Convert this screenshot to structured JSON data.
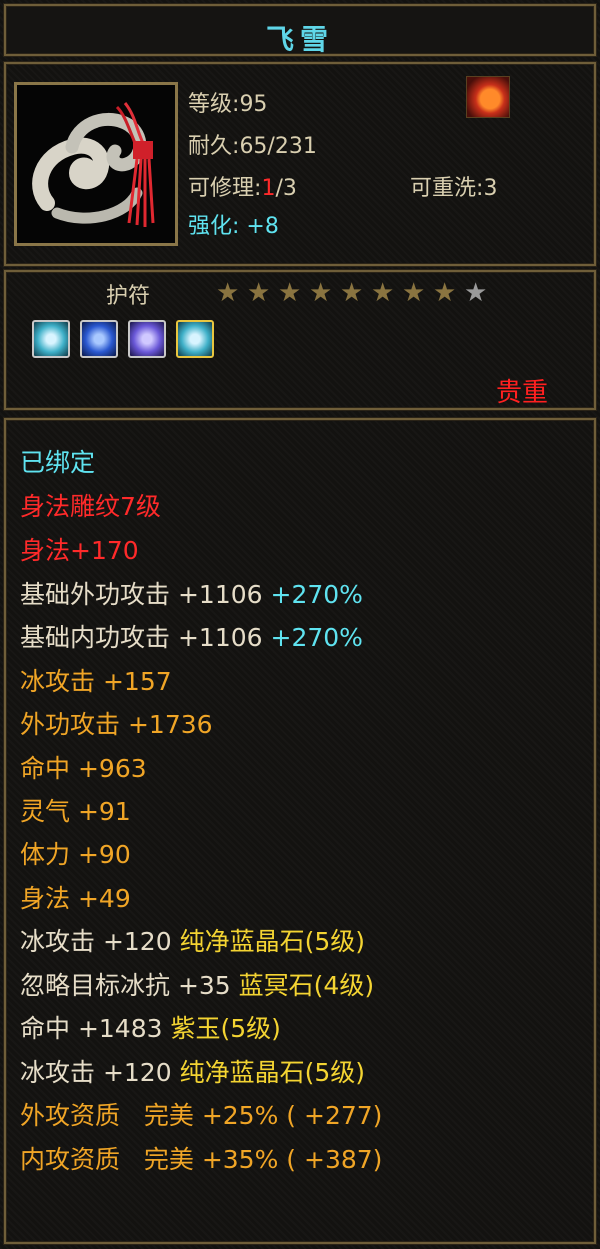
{
  "item": {
    "name": "飞雪",
    "level_label": "等级",
    "level": "95",
    "durability_label": "耐久",
    "durability": "65/231",
    "repairable_label": "可修理",
    "repairable_current": "1",
    "repairable_total": "/3",
    "rewash_label": "可重洗",
    "rewash": "3",
    "enhance_label": "强化",
    "enhance": "+8",
    "type": "护符",
    "stars_filled": 8,
    "stars_total": 9,
    "rarity": "贵重",
    "gem_slots": [
      {
        "icon": "cyan-gem-icon",
        "color": "#3fb0c8"
      },
      {
        "icon": "blue-gem-icon",
        "color": "#2a58d0"
      },
      {
        "icon": "purple-gem-icon",
        "color": "#6a58d8"
      },
      {
        "icon": "cyan-gem-icon",
        "color": "#3fb0c8"
      }
    ]
  },
  "attributes": {
    "bound": "已绑定",
    "engraving": "身法雕纹7级",
    "engraving_bonus": "身法+170",
    "base_ext_attack": {
      "label": "基础外功攻击",
      "value": "+1106",
      "percent": "+270%"
    },
    "base_int_attack": {
      "label": "基础内功攻击",
      "value": "+1106",
      "percent": "+270%"
    },
    "stats": [
      {
        "label": "冰攻击",
        "value": "+157"
      },
      {
        "label": "外功攻击",
        "value": "+1736"
      },
      {
        "label": "命中",
        "value": "+963"
      },
      {
        "label": "灵气",
        "value": "+91"
      },
      {
        "label": "体力",
        "value": "+90"
      },
      {
        "label": "身法",
        "value": "+49"
      }
    ],
    "gems": [
      {
        "stat": "冰攻击 +120",
        "gem": "纯净蓝晶石(5级)"
      },
      {
        "stat": "忽略目标冰抗 +35",
        "gem": "蓝冥石(4级)"
      },
      {
        "stat": "命中 +1483",
        "gem": "紫玉(5级)"
      },
      {
        "stat": "冰攻击 +120",
        "gem": "纯净蓝晶石(5级)"
      }
    ],
    "aptitudes": [
      {
        "label": "外攻资质",
        "grade": "完美",
        "percent": "+25%",
        "bonus": "( +277)"
      },
      {
        "label": "内攻资质",
        "grade": "完美",
        "percent": "+35%",
        "bonus": "( +387)"
      }
    ]
  }
}
